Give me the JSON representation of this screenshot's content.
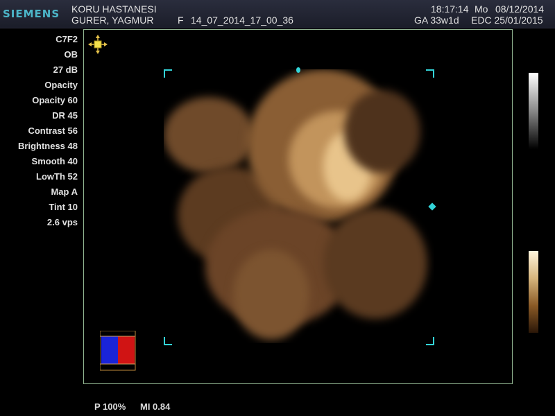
{
  "header": {
    "brand": "SIEMENS",
    "institution": "KORU HASTANESI",
    "patient": "GURER, YAGMUR",
    "frequency_mark": "F",
    "study_id": "14_07_2014_17_00_36",
    "time": "18:17:14",
    "weekday": "Mo",
    "date": "08/12/2014",
    "ga": "GA 33w1d",
    "edc": "EDC 25/01/2015"
  },
  "params": [
    "C7F2",
    "OB",
    "27 dB",
    "Opacity",
    "Opacity 60",
    "DR 45",
    "Contrast 56",
    "Brightness 48",
    "Smooth 40",
    "LowTh 52",
    "Map A",
    "Tint 10",
    "2.6 vps"
  ],
  "footer": {
    "power": "P 100%",
    "mi": "MI 0.84"
  },
  "icons": [
    "axis-orientation-icon",
    "depth-marker-icon",
    "side-marker-icon",
    "color-orientation-icon"
  ],
  "colors": {
    "accent": "#33d4d8",
    "frame": "#8fb38f",
    "sepia": "#b88a55"
  }
}
